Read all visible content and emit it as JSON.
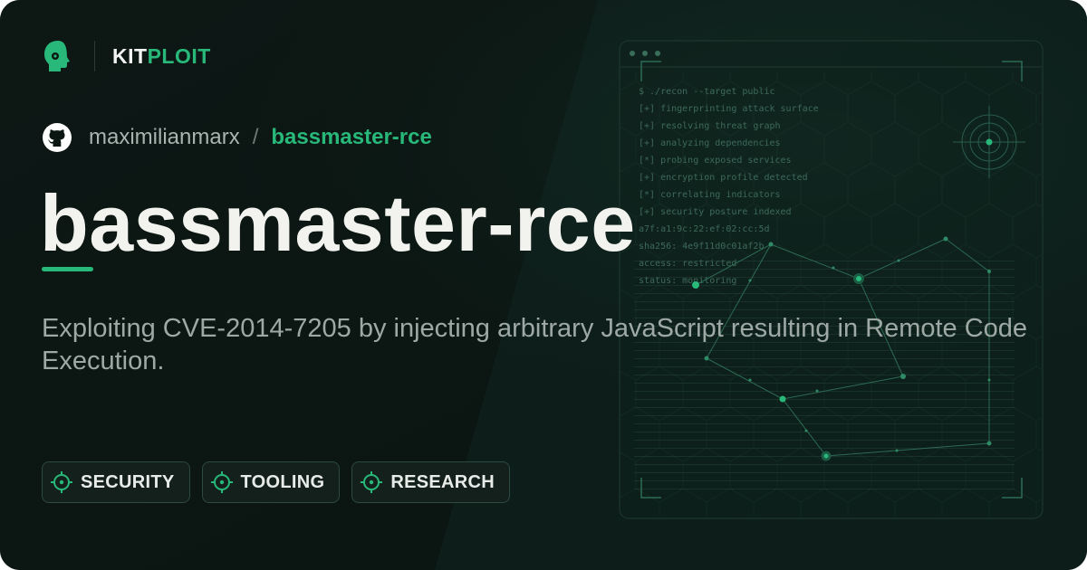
{
  "brand": {
    "icon": "kitploit-head-logo",
    "name_part1": "KIT",
    "name_part2": "PLOIT"
  },
  "repo": {
    "icon": "github-icon",
    "owner": "maximilianmarx",
    "separator": "/",
    "name": "bassmaster-rce"
  },
  "title": "bassmaster-rce",
  "description": "Exploiting CVE-2014-7205 by injecting arbitrary JavaScript resulting in Remote Code Execution.",
  "tags": [
    {
      "label": "SECURITY",
      "icon": "crosshair-icon"
    },
    {
      "label": "TOOLING",
      "icon": "crosshair-icon"
    },
    {
      "label": "RESEARCH",
      "icon": "crosshair-icon"
    }
  ],
  "terminal_lines": [
    "$ ./recon --target public",
    "[+] fingerprinting attack surface",
    "[+] resolving threat graph",
    "[+] analyzing dependencies",
    "[*] probing exposed services",
    "[+] encryption profile detected",
    "[*] correlating indicators",
    "[+] security posture indexed",
    "a7f:a1:9c:22:ef:02:cc:5d",
    "sha256: 4e9f11d0c01af2b",
    "access: restricted",
    "status: monitoring"
  ],
  "colors": {
    "background": "#0b1512",
    "accent": "#27b87a",
    "title": "#f2f3ef",
    "muted_text": "#9ea9a5",
    "tag_border": "#2d4a3f"
  }
}
